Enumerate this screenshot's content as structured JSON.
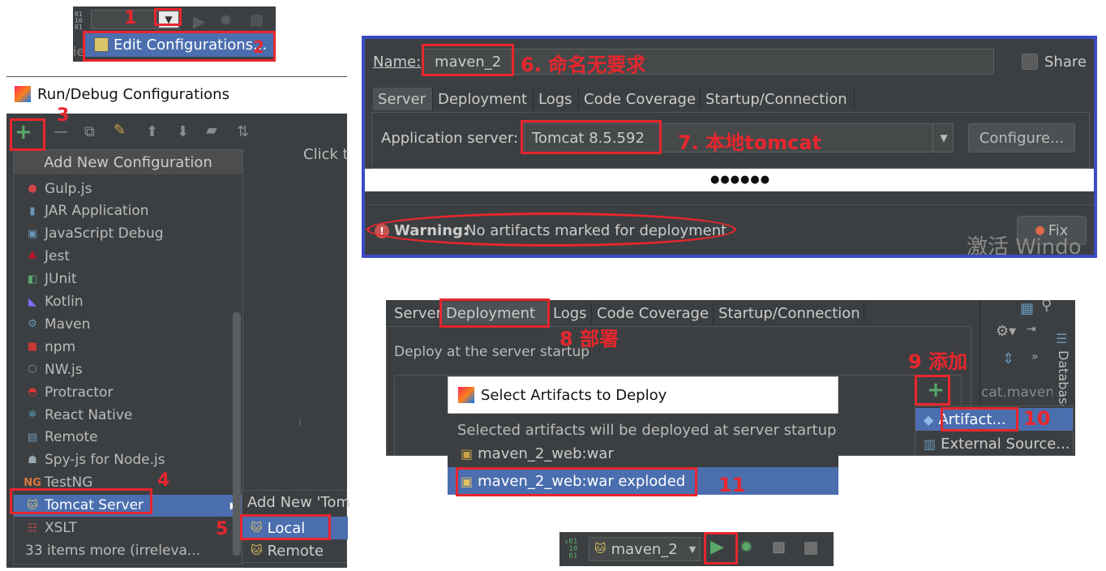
{
  "steps": {
    "s1": "1",
    "s2": "2",
    "s3": "3",
    "s4": "4",
    "s5": "5",
    "s6": "6. 命名无要求",
    "s7": "7. 本地tomcat",
    "s8": "8 部署",
    "s9": "9 添加",
    "s10": "10",
    "s11": "11"
  },
  "panel1": {
    "edit_configurations": "Edit Configurations...",
    "side_fragment": "ie"
  },
  "panel2": {
    "title": "Run/Debug Configurations",
    "add_new_configuration": "Add New Configuration",
    "click_fragment": "Click t",
    "items": [
      {
        "label": "Gulp.js",
        "icon": "gulp-icon"
      },
      {
        "label": "JAR Application",
        "icon": "jar-icon"
      },
      {
        "label": "JavaScript Debug",
        "icon": "js-debug-icon"
      },
      {
        "label": "Jest",
        "icon": "jest-icon"
      },
      {
        "label": "JUnit",
        "icon": "junit-icon"
      },
      {
        "label": "Kotlin",
        "icon": "kotlin-icon"
      },
      {
        "label": "Maven",
        "icon": "maven-icon"
      },
      {
        "label": "npm",
        "icon": "npm-icon"
      },
      {
        "label": "NW.js",
        "icon": "nwjs-icon"
      },
      {
        "label": "Protractor",
        "icon": "protractor-icon"
      },
      {
        "label": "React Native",
        "icon": "react-icon"
      },
      {
        "label": "Remote",
        "icon": "remote-icon"
      },
      {
        "label": "Spy-js for Node.js",
        "icon": "spyjs-icon"
      },
      {
        "label": "TestNG",
        "icon": "testng-icon"
      },
      {
        "label": "Tomcat Server",
        "icon": "tomcat-icon"
      },
      {
        "label": "XSLT",
        "icon": "xslt-icon"
      },
      {
        "label": "33 items more (irreleva...",
        "icon": ""
      }
    ],
    "submenu_title": "Add New 'Tom",
    "submenu_local": "Local",
    "submenu_remote": "Remote"
  },
  "panel3": {
    "name_label": "Name:",
    "name_value": "maven_2",
    "share_label": "Share",
    "tabs": [
      "Server",
      "Deployment",
      "Logs",
      "Code Coverage",
      "Startup/Connection"
    ],
    "app_server_label": "Application server:",
    "app_server_value": "Tomcat 8.5.592",
    "configure_label": "Configure...",
    "dots": "●●●●●●",
    "warning_bold": "Warning:",
    "warning_text": "No artifacts marked for deployment",
    "fix_label": "Fix",
    "watermark": "激活 Windo"
  },
  "panel4": {
    "tabs": [
      "Server",
      "Deployment",
      "Logs",
      "Code Coverage",
      "Startup/Connection"
    ],
    "deploy_text": "Deploy at the server startup",
    "dialog_title": "Select Artifacts to Deploy",
    "dialog_subtitle": "Selected artifacts will be deployed at server startup",
    "artifact1": "maven_2_web:war",
    "artifact2": "maven_2_web:war exploded",
    "popup_artifact": "Artifact...",
    "popup_external": "External Source...",
    "side_text": "cat.maven",
    "database_label": "Database"
  },
  "panel5": {
    "run_config": "maven_2"
  }
}
